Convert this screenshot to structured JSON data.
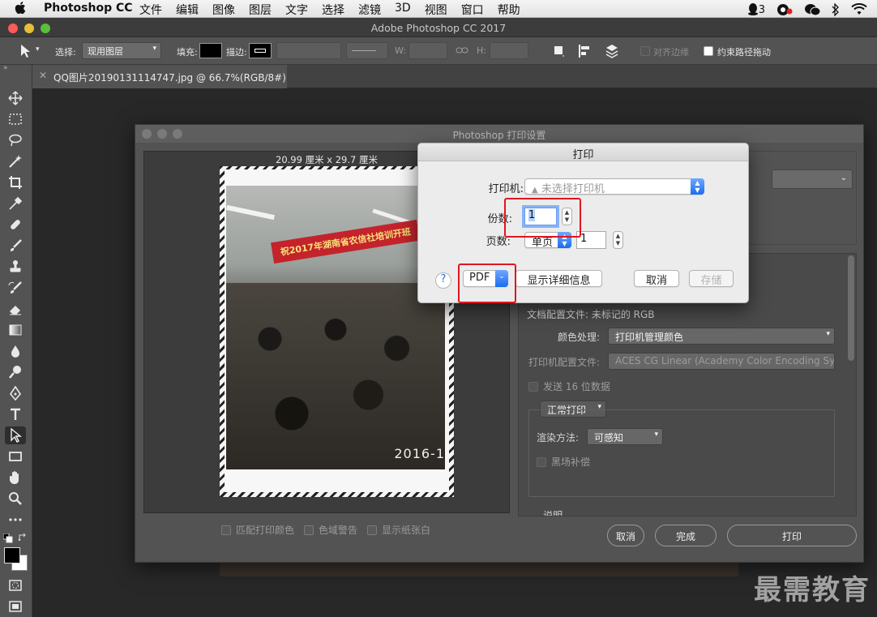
{
  "menubar": {
    "app_name": "Photoshop CC",
    "menus": [
      "文件",
      "编辑",
      "图像",
      "图层",
      "文字",
      "选择",
      "滤镜",
      "3D",
      "视图",
      "窗口",
      "帮助"
    ],
    "status_badge": "3"
  },
  "window": {
    "title": "Adobe Photoshop CC 2017"
  },
  "options_bar": {
    "select_label": "选择:",
    "select_value": "现用图层",
    "fill_label": "填充:",
    "stroke_label": "描边:",
    "w_label": "W:",
    "h_label": "H:",
    "align_edges_label": "对齐边缘",
    "constrain_path_label": "约束路径拖动"
  },
  "document_tab": {
    "name": "QQ图片20190131114747.jpg @ 66.7%(RGB/8#)"
  },
  "ps_print_dialog": {
    "title": "Photoshop 打印设置",
    "paper_size": "20.99 厘米 x 29.7 厘米",
    "photo_banner": "祝2017年湖南省农信社培训开班",
    "photo_date": "2016-1",
    "checkboxes": [
      "匹配打印颜色",
      "色域警告",
      "显示纸张白"
    ],
    "doc_profile": "文档配置文件: 未标记的 RGB",
    "color_handling_label": "颜色处理:",
    "color_handling_value": "打印机管理颜色",
    "printer_profile_label": "打印机配置文件:",
    "printer_profile_value": "ACES CG Linear (Academy Color Encoding Sy...",
    "send16_label": "发送 16 位数据",
    "print_mode": "正常打印",
    "render_label": "渲染方法:",
    "render_value": "可感知",
    "blackpoint_label": "黑场补偿",
    "description_label": "说明",
    "cancel": "取消",
    "done": "完成",
    "print": "打印"
  },
  "mac_print_dialog": {
    "title": "打印",
    "printer_label": "打印机:",
    "printer_value": "未选择打印机",
    "copies_label": "份数:",
    "copies_value": "1",
    "pages_label": "页数:",
    "pages_mode": "单页",
    "pages_value": "1",
    "help": "?",
    "pdf": "PDF",
    "show_details": "显示详细信息",
    "cancel": "取消",
    "save": "存储"
  },
  "watermark": "最需教育",
  "colors": {
    "highlight_red": "#e01620",
    "mac_blue": "#1b6cf0"
  }
}
